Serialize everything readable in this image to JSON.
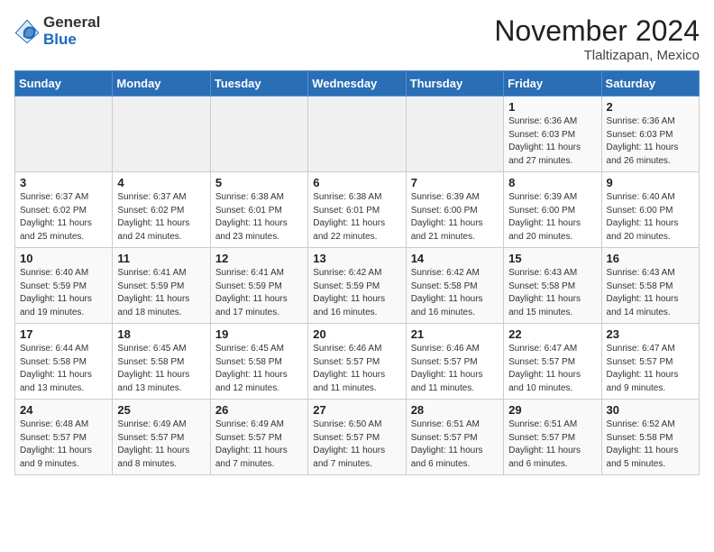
{
  "logo": {
    "general": "General",
    "blue": "Blue"
  },
  "title": "November 2024",
  "subtitle": "Tlaltizapan, Mexico",
  "weekdays": [
    "Sunday",
    "Monday",
    "Tuesday",
    "Wednesday",
    "Thursday",
    "Friday",
    "Saturday"
  ],
  "weeks": [
    [
      {
        "day": "",
        "info": ""
      },
      {
        "day": "",
        "info": ""
      },
      {
        "day": "",
        "info": ""
      },
      {
        "day": "",
        "info": ""
      },
      {
        "day": "",
        "info": ""
      },
      {
        "day": "1",
        "info": "Sunrise: 6:36 AM\nSunset: 6:03 PM\nDaylight: 11 hours and 27 minutes."
      },
      {
        "day": "2",
        "info": "Sunrise: 6:36 AM\nSunset: 6:03 PM\nDaylight: 11 hours and 26 minutes."
      }
    ],
    [
      {
        "day": "3",
        "info": "Sunrise: 6:37 AM\nSunset: 6:02 PM\nDaylight: 11 hours and 25 minutes."
      },
      {
        "day": "4",
        "info": "Sunrise: 6:37 AM\nSunset: 6:02 PM\nDaylight: 11 hours and 24 minutes."
      },
      {
        "day": "5",
        "info": "Sunrise: 6:38 AM\nSunset: 6:01 PM\nDaylight: 11 hours and 23 minutes."
      },
      {
        "day": "6",
        "info": "Sunrise: 6:38 AM\nSunset: 6:01 PM\nDaylight: 11 hours and 22 minutes."
      },
      {
        "day": "7",
        "info": "Sunrise: 6:39 AM\nSunset: 6:00 PM\nDaylight: 11 hours and 21 minutes."
      },
      {
        "day": "8",
        "info": "Sunrise: 6:39 AM\nSunset: 6:00 PM\nDaylight: 11 hours and 20 minutes."
      },
      {
        "day": "9",
        "info": "Sunrise: 6:40 AM\nSunset: 6:00 PM\nDaylight: 11 hours and 20 minutes."
      }
    ],
    [
      {
        "day": "10",
        "info": "Sunrise: 6:40 AM\nSunset: 5:59 PM\nDaylight: 11 hours and 19 minutes."
      },
      {
        "day": "11",
        "info": "Sunrise: 6:41 AM\nSunset: 5:59 PM\nDaylight: 11 hours and 18 minutes."
      },
      {
        "day": "12",
        "info": "Sunrise: 6:41 AM\nSunset: 5:59 PM\nDaylight: 11 hours and 17 minutes."
      },
      {
        "day": "13",
        "info": "Sunrise: 6:42 AM\nSunset: 5:59 PM\nDaylight: 11 hours and 16 minutes."
      },
      {
        "day": "14",
        "info": "Sunrise: 6:42 AM\nSunset: 5:58 PM\nDaylight: 11 hours and 16 minutes."
      },
      {
        "day": "15",
        "info": "Sunrise: 6:43 AM\nSunset: 5:58 PM\nDaylight: 11 hours and 15 minutes."
      },
      {
        "day": "16",
        "info": "Sunrise: 6:43 AM\nSunset: 5:58 PM\nDaylight: 11 hours and 14 minutes."
      }
    ],
    [
      {
        "day": "17",
        "info": "Sunrise: 6:44 AM\nSunset: 5:58 PM\nDaylight: 11 hours and 13 minutes."
      },
      {
        "day": "18",
        "info": "Sunrise: 6:45 AM\nSunset: 5:58 PM\nDaylight: 11 hours and 13 minutes."
      },
      {
        "day": "19",
        "info": "Sunrise: 6:45 AM\nSunset: 5:58 PM\nDaylight: 11 hours and 12 minutes."
      },
      {
        "day": "20",
        "info": "Sunrise: 6:46 AM\nSunset: 5:57 PM\nDaylight: 11 hours and 11 minutes."
      },
      {
        "day": "21",
        "info": "Sunrise: 6:46 AM\nSunset: 5:57 PM\nDaylight: 11 hours and 11 minutes."
      },
      {
        "day": "22",
        "info": "Sunrise: 6:47 AM\nSunset: 5:57 PM\nDaylight: 11 hours and 10 minutes."
      },
      {
        "day": "23",
        "info": "Sunrise: 6:47 AM\nSunset: 5:57 PM\nDaylight: 11 hours and 9 minutes."
      }
    ],
    [
      {
        "day": "24",
        "info": "Sunrise: 6:48 AM\nSunset: 5:57 PM\nDaylight: 11 hours and 9 minutes."
      },
      {
        "day": "25",
        "info": "Sunrise: 6:49 AM\nSunset: 5:57 PM\nDaylight: 11 hours and 8 minutes."
      },
      {
        "day": "26",
        "info": "Sunrise: 6:49 AM\nSunset: 5:57 PM\nDaylight: 11 hours and 7 minutes."
      },
      {
        "day": "27",
        "info": "Sunrise: 6:50 AM\nSunset: 5:57 PM\nDaylight: 11 hours and 7 minutes."
      },
      {
        "day": "28",
        "info": "Sunrise: 6:51 AM\nSunset: 5:57 PM\nDaylight: 11 hours and 6 minutes."
      },
      {
        "day": "29",
        "info": "Sunrise: 6:51 AM\nSunset: 5:57 PM\nDaylight: 11 hours and 6 minutes."
      },
      {
        "day": "30",
        "info": "Sunrise: 6:52 AM\nSunset: 5:58 PM\nDaylight: 11 hours and 5 minutes."
      }
    ]
  ]
}
